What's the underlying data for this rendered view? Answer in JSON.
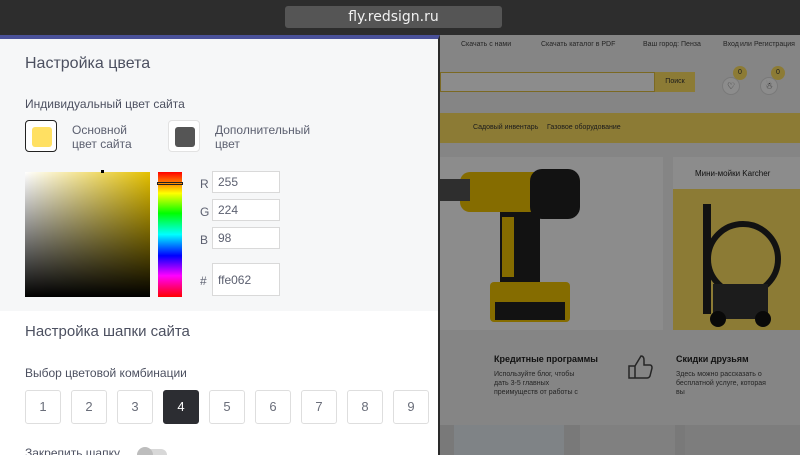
{
  "browser": {
    "url": "fly.redsign.ru"
  },
  "panel": {
    "color_section_title": "Настройка цвета",
    "individual_color_label": "Индивидуальный цвет сайта",
    "primary_swatch": {
      "label_line1": "Основной",
      "label_line2": "цвет сайта",
      "color": "#ffe062"
    },
    "secondary_swatch": {
      "label_line1": "Дополнительный",
      "label_line2": "цвет",
      "color": "#555555"
    },
    "rgb": {
      "r_label": "R",
      "r_value": "255",
      "g_label": "G",
      "g_value": "224",
      "b_label": "B",
      "b_value": "98",
      "hex_label": "#",
      "hex_value": "ffe062"
    },
    "header_section_title": "Настройка шапки сайта",
    "combo_label": "Выбор цветовой комбинации",
    "combos": [
      "1",
      "2",
      "3",
      "4",
      "5",
      "6",
      "7",
      "8",
      "9"
    ],
    "selected_combo": "4",
    "pin_header_label": "Закрепить шапку",
    "pin_header_on": false,
    "accent_color": "#4a5199"
  },
  "site": {
    "toplinks": [
      "Скачать с нами",
      "Скачать каталог в PDF",
      "Ваш город: Пенза",
      "Вход",
      "или",
      "Регистрация"
    ],
    "search_button": "Поиск",
    "wishlist_count": "0",
    "cart_count": "0",
    "menu": [
      "Садовый инвентарь",
      "Газовое оборудование"
    ],
    "promo_title": "Мини-мойки Karcher",
    "info": [
      {
        "title": "Кредитные программы",
        "text": "Используйте блог, чтобы дать 3-5 главных преимуществ от работы с"
      },
      {
        "title": "Скидки друзьям",
        "text": "Здесь можно рассказать о бесплатной услуге, которая вы"
      }
    ]
  }
}
